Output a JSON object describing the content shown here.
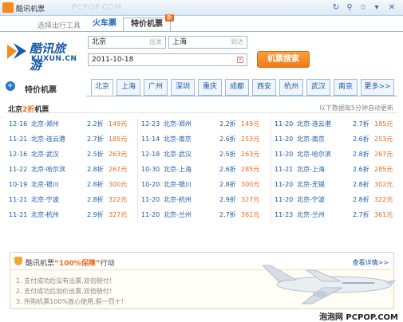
{
  "window": {
    "title": "酷讯机票"
  },
  "watermark": "PCPOP.COM",
  "tabs": {
    "tools": "选择出行工具",
    "train": "火车票",
    "flight": "特价机票",
    "flight_badge": "新"
  },
  "brand": {
    "cn": "酷讯旅游",
    "en": "KUXUN.CN"
  },
  "search": {
    "from": "北京",
    "from_hint": "出发",
    "to": "上海",
    "to_hint": "到达",
    "date": "2011-10-18",
    "button": "机票搜索"
  },
  "city_bar": {
    "label": "特价机票",
    "cities": [
      "北京",
      "上海",
      "广州",
      "深圳",
      "重庆",
      "成都",
      "西安",
      "杭州",
      "武汉",
      "南京",
      "更多>>"
    ],
    "active": "北京"
  },
  "section": {
    "prefix": "北京",
    "highlight": "2折",
    "suffix": "机票",
    "note": "以下数据每5分钟自动更新"
  },
  "table": [
    [
      {
        "date": "12-16",
        "route": "北京-郑州",
        "disc": "2.2折",
        "price": "149元"
      },
      {
        "date": "12-23",
        "route": "北京-郑州",
        "disc": "2.2折",
        "price": "149元"
      },
      {
        "date": "11-20",
        "route": "北京-连云港",
        "disc": "2.7折",
        "price": "185元"
      }
    ],
    [
      {
        "date": "11-21",
        "route": "北京-连云港",
        "disc": "2.7折",
        "price": "185元"
      },
      {
        "date": "11-14",
        "route": "北京-南京",
        "disc": "2.6折",
        "price": "253元"
      },
      {
        "date": "11-20",
        "route": "北京-南京",
        "disc": "2.6折",
        "price": "253元"
      }
    ],
    [
      {
        "date": "12-16",
        "route": "北京-武汉",
        "disc": "2.5折",
        "price": "263元"
      },
      {
        "date": "12-18",
        "route": "北京-武汉",
        "disc": "2.5折",
        "price": "263元"
      },
      {
        "date": "11-20",
        "route": "北京-哈尔滨",
        "disc": "2.8折",
        "price": "267元"
      }
    ],
    [
      {
        "date": "11-22",
        "route": "北京-哈尔滨",
        "disc": "2.8折",
        "price": "267元"
      },
      {
        "date": "10-30",
        "route": "北京-上海",
        "disc": "2.6折",
        "price": "285元"
      },
      {
        "date": "11-21",
        "route": "北京-上海",
        "disc": "2.6折",
        "price": "285元"
      }
    ],
    [
      {
        "date": "10-19",
        "route": "北京-银川",
        "disc": "2.8折",
        "price": "300元"
      },
      {
        "date": "10-20",
        "route": "北京-银川",
        "disc": "2.8折",
        "price": "300元"
      },
      {
        "date": "11-20",
        "route": "北京-无锡",
        "disc": "2.8折",
        "price": "302元"
      }
    ],
    [
      {
        "date": "11-21",
        "route": "北京-宁波",
        "disc": "2.8折",
        "price": "322元"
      },
      {
        "date": "11-20",
        "route": "北京-杭州",
        "disc": "2.9折",
        "price": "327元"
      },
      {
        "date": "11-20",
        "route": "北京-宁波",
        "disc": "2.8折",
        "price": "322元"
      }
    ],
    [
      {
        "date": "11-21",
        "route": "北京-杭州",
        "disc": "2.9折",
        "price": "327元"
      },
      {
        "date": "11-20",
        "route": "北京-兰州",
        "disc": "2.7折",
        "price": "361元"
      },
      {
        "date": "11-23",
        "route": "北京-兰州",
        "disc": "2.7折",
        "price": "361元"
      }
    ]
  ],
  "promo": {
    "title_pre": "酷讯机票",
    "title_hl": "“100%保障”",
    "title_post": "行动",
    "more": "查看详情>>",
    "lines": [
      "1. 支付成功后没有出票,双倍赔付！",
      "2. 支付成功后加价出票,双倍赔付！",
      "3. 所购机票100%放心使用,假一罚十！"
    ]
  },
  "footer": "泡泡网 PCPOP.COM"
}
